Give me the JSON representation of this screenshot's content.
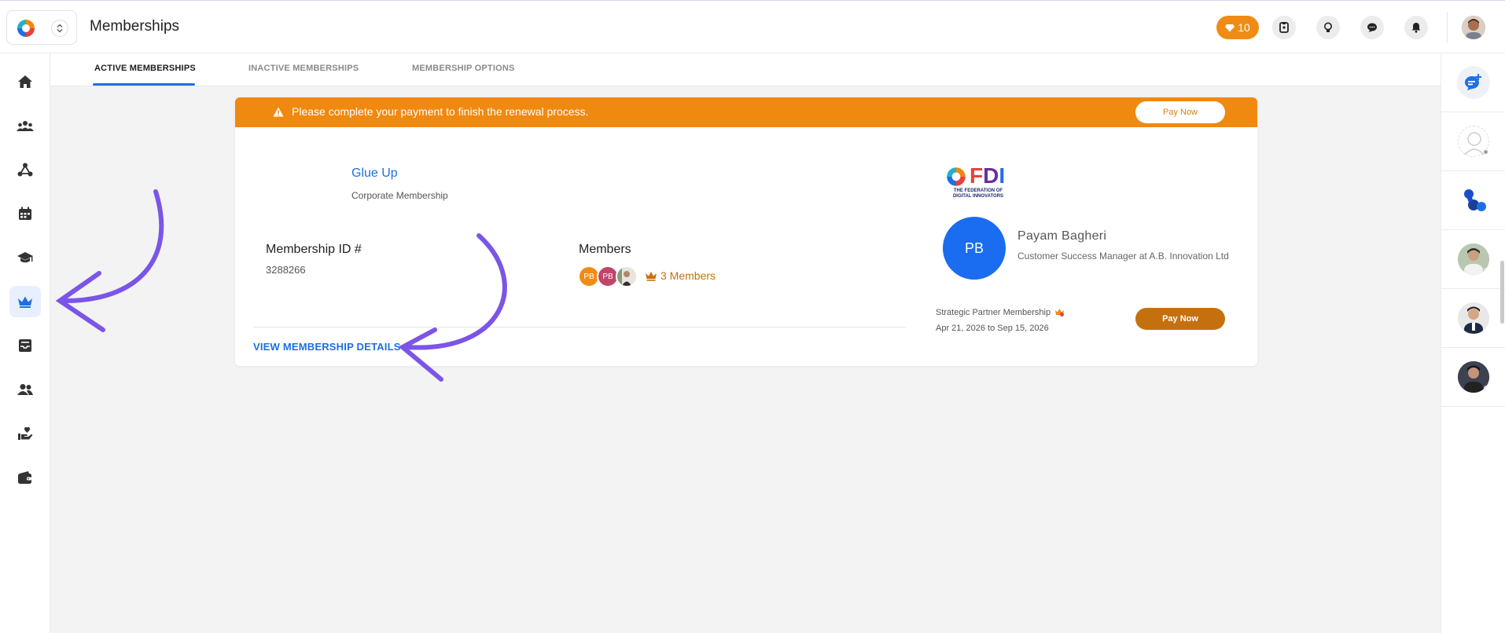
{
  "header": {
    "title": "Memberships",
    "points": "10",
    "colors": {
      "accent": "#1f6fe3",
      "orange": "#f0890f",
      "brown": "#c5700e"
    }
  },
  "sidebar": {
    "items": [
      {
        "icon": "home-icon"
      },
      {
        "icon": "community-icon"
      },
      {
        "icon": "network-icon"
      },
      {
        "icon": "calendar-icon"
      },
      {
        "icon": "graduation-cap-icon"
      },
      {
        "icon": "crown-icon",
        "active": true
      },
      {
        "icon": "inbox-icon"
      },
      {
        "icon": "people-icon"
      },
      {
        "icon": "volunteer-icon"
      },
      {
        "icon": "wallet-icon"
      }
    ]
  },
  "tabs": [
    {
      "label": "ACTIVE MEMBERSHIPS",
      "active": true
    },
    {
      "label": "INACTIVE MEMBERSHIPS"
    },
    {
      "label": "MEMBERSHIP OPTIONS"
    }
  ],
  "banner": {
    "message": "Please complete your payment to finish the renewal process.",
    "pay_label": "Pay Now"
  },
  "membership": {
    "org_name": "Glue Up",
    "org_type": "Corporate Membership",
    "id_label": "Membership ID #",
    "id_value": "3288266",
    "members_label": "Members",
    "member_avatars": [
      "PB",
      "PB",
      ""
    ],
    "members_count": "3 Members",
    "view_details": "VIEW MEMBERSHIP DETAILS"
  },
  "partner": {
    "logo_text": "FDI",
    "logo_subtitle": "THE FEDERATION OF DIGITAL INNOVATORS",
    "contact_initials": "PB",
    "contact_name": "Payam Bagheri",
    "contact_role": "Customer Success Manager at A.B. Innovation Ltd",
    "plan_name": "Strategic Partner Membership",
    "plan_dates": "Apr 21, 2026 to Sep 15, 2026",
    "pay_label": "Pay Now"
  }
}
